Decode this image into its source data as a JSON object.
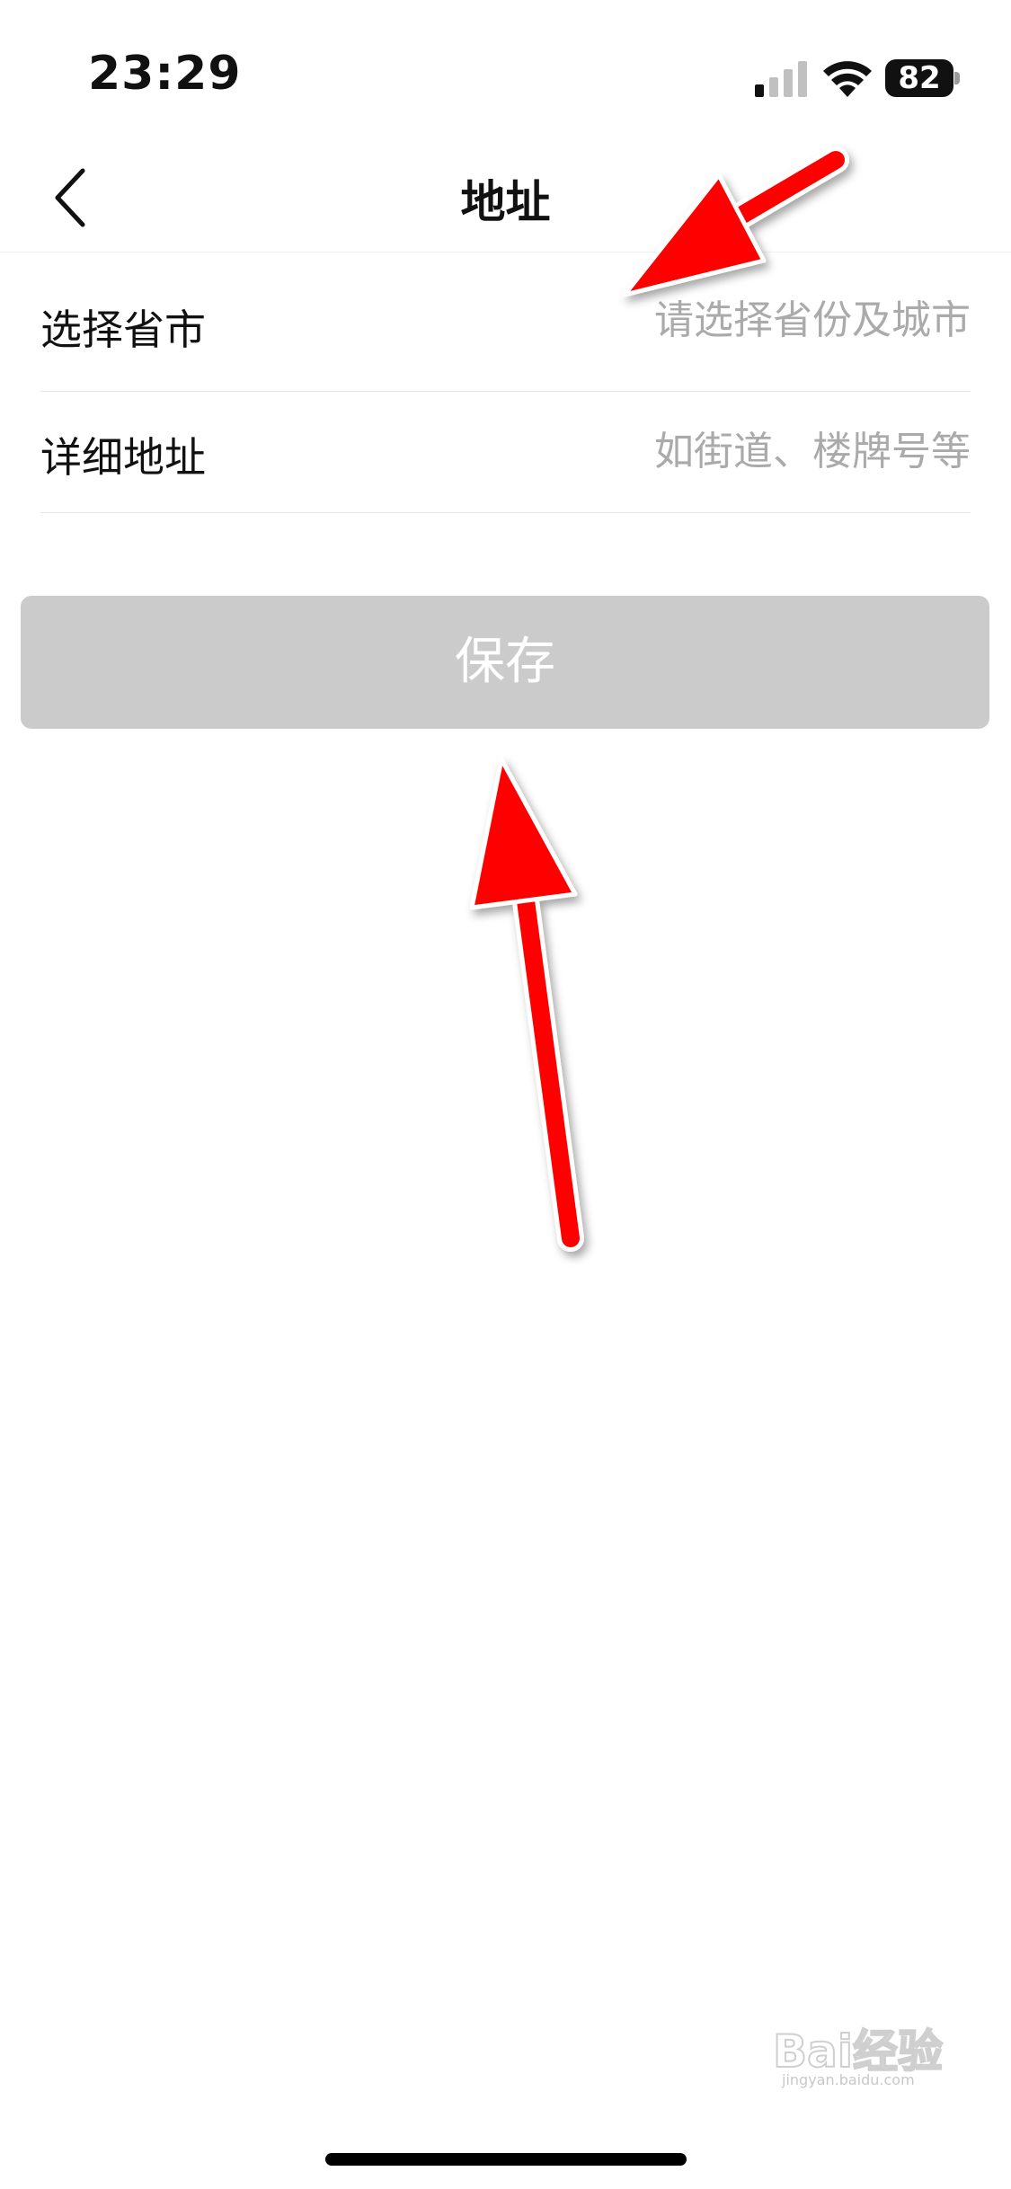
{
  "status_bar": {
    "time": "23:29",
    "battery_level": "82"
  },
  "nav": {
    "title": "地址",
    "back_icon": "chevron-left-icon"
  },
  "form": {
    "province_row": {
      "label": "选择省市",
      "placeholder": "请选择省份及城市",
      "value": ""
    },
    "detail_row": {
      "label": "详细地址",
      "placeholder": "如街道、楼牌号等",
      "value": ""
    }
  },
  "save_button": {
    "label": "保存",
    "color": "#cbcbcb"
  },
  "annotation": {
    "arrow_color": "#ff0000"
  },
  "watermark": {
    "text": "Bai经验",
    "sub": "jingyan.baidu.com"
  }
}
